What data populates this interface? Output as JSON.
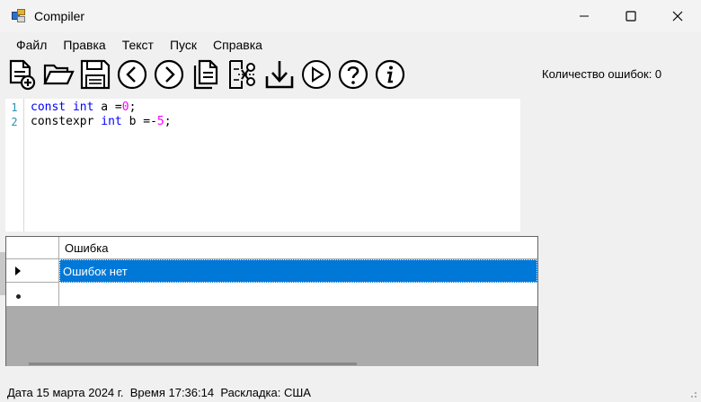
{
  "window": {
    "title": "Compiler"
  },
  "menu": [
    "Файл",
    "Правка",
    "Текст",
    "Пуск",
    "Справка"
  ],
  "toolbar": [
    "new-file",
    "open-folder",
    "save",
    "undo",
    "redo",
    "copy",
    "cut",
    "paste",
    "run",
    "help",
    "info"
  ],
  "error_count_label": "Количество ошибок: 0",
  "editor": {
    "line_numbers": [
      "1",
      "2"
    ],
    "lines": [
      [
        {
          "t": "const",
          "k": "kw"
        },
        {
          "t": " ",
          "k": ""
        },
        {
          "t": "int",
          "k": "kw"
        },
        {
          "t": " a =",
          "k": ""
        },
        {
          "t": "0",
          "k": "num"
        },
        {
          "t": ";",
          "k": ""
        }
      ],
      [
        {
          "t": "constexpr ",
          "k": ""
        },
        {
          "t": "int",
          "k": "kw"
        },
        {
          "t": " b =-",
          "k": ""
        },
        {
          "t": "5",
          "k": "num"
        },
        {
          "t": ";",
          "k": ""
        }
      ]
    ]
  },
  "grid": {
    "column_header": "Ошибка",
    "rows": [
      "Ошибок нет"
    ]
  },
  "status": {
    "date": "Дата 15 марта 2024 г.",
    "time": "Время 17:36:14",
    "layout": "Раскладка: США"
  }
}
